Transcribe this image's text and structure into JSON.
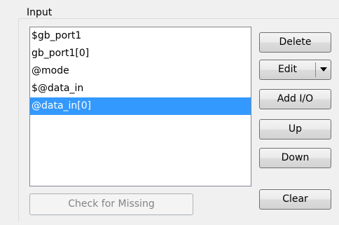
{
  "group": {
    "title": "Input"
  },
  "list": {
    "items": [
      {
        "label": "$gb_port1",
        "selected": false
      },
      {
        "label": "gb_port1[0]",
        "selected": false
      },
      {
        "label": "@mode",
        "selected": false
      },
      {
        "label": "$@data_in",
        "selected": false
      },
      {
        "label": "@data_in[0]",
        "selected": true
      }
    ]
  },
  "buttons": {
    "delete": "Delete",
    "edit": "Edit",
    "add_io": "Add I/O",
    "up": "Up",
    "down": "Down",
    "clear": "Clear",
    "check_missing": "Check for Missing"
  },
  "colors": {
    "selection": "#3399ff",
    "disabled_text": "#838383"
  }
}
